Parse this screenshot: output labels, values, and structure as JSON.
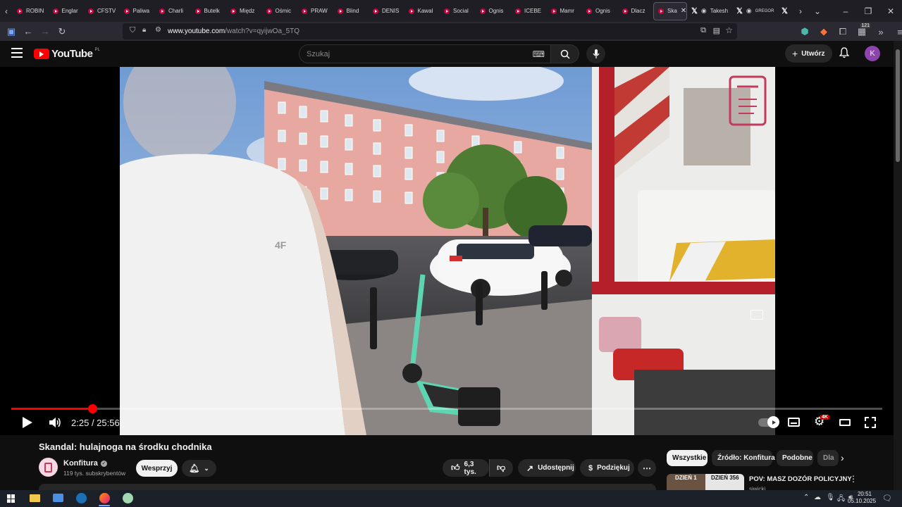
{
  "browser": {
    "tabs": [
      {
        "label": "ROBIN"
      },
      {
        "label": "Englar"
      },
      {
        "label": "CFSTV"
      },
      {
        "label": "Paliwa"
      },
      {
        "label": "Charli"
      },
      {
        "label": "Butelk"
      },
      {
        "label": "Międz"
      },
      {
        "label": "Ośmic"
      },
      {
        "label": "PRAW"
      },
      {
        "label": "Blind"
      },
      {
        "label": "DENIS"
      },
      {
        "label": "Kawal"
      },
      {
        "label": "Social"
      },
      {
        "label": "Ognis"
      },
      {
        "label": "ICEBE"
      },
      {
        "label": "Mamr"
      },
      {
        "label": "Ognis"
      },
      {
        "label": "Dlacz"
      }
    ],
    "active_tab": {
      "label": "Ska"
    },
    "x_tabs": [
      {
        "label": "Takesh"
      },
      {
        "label": "GREGOR"
      }
    ],
    "url_domain": "www.youtube.com",
    "url_path": "/watch?v=qyijwOa_5TQ",
    "extension_badge": "121"
  },
  "youtube": {
    "logo_text": "YouTube",
    "region": "PL",
    "search_placeholder": "Szukaj",
    "create_label": "Utwórz",
    "avatar_letter": "K"
  },
  "player": {
    "current_time": "2:25",
    "duration": "25:56",
    "progress": 0.0933,
    "quality_badge": "4K"
  },
  "video": {
    "title": "Skandal: hulajnoga na środku chodnika",
    "channel": "Konfitura",
    "subscribers": "119 tys. subskrybentów",
    "support_label": "Wesprzyj",
    "likes": "6,3 tys.",
    "share_label": "Udostępnij",
    "thanks_label": "Podziękuj"
  },
  "chips": [
    {
      "label": "Wszystkie",
      "active": true
    },
    {
      "label": "Źródło: Konfitura",
      "active": false
    },
    {
      "label": "Podobne",
      "active": false
    },
    {
      "label": "Dla",
      "active": false
    }
  ],
  "recommended": {
    "thumb_left_text": "DZIEŃ 1",
    "thumb_right_text": "DZIEŃ 356",
    "title": "POV: MASZ DOZÓR POLICYJNY",
    "channel_partial": "siwicki"
  },
  "taskbar": {
    "time": "20:51",
    "date": "05.10.2025"
  },
  "colors": {
    "accent_red": "#ff0000",
    "tab_favicon": "#c3073f",
    "yt_bg": "#0f0f0f",
    "avatar": "#8e44ad"
  }
}
